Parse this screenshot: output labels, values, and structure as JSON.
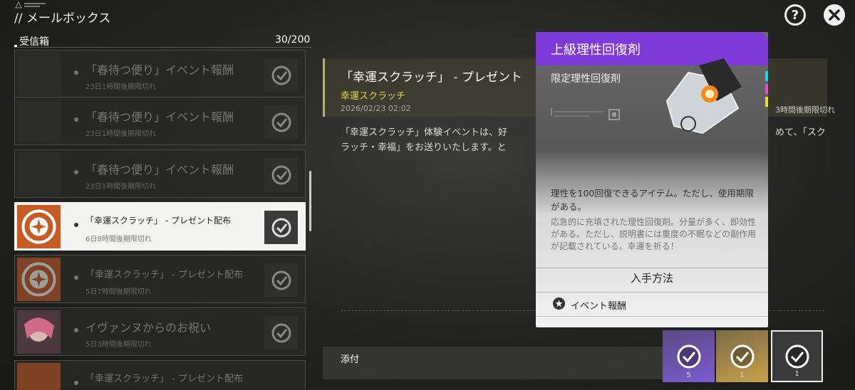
{
  "header": {
    "title": "// メールボックス",
    "help_label": "?"
  },
  "inbox": {
    "label": "受信箱",
    "count": "30/200",
    "items": [
      {
        "title": "「春待つ便り」イベント報酬",
        "sub": "23日1時間後期限切れ",
        "state": "read"
      },
      {
        "title": "「春待つ便り」イベント報酬",
        "sub": "23日1時間後期限切れ",
        "state": "read"
      },
      {
        "title": "「春待つ便り」イベント報酬",
        "sub": "23日1時間後期限切れ",
        "state": "read"
      },
      {
        "title": "「幸運スクラッチ」 - プレゼント配布",
        "sub": "6日8時間後期限切れ",
        "state": "selected"
      },
      {
        "title": "「幸運スクラッチ」 - プレゼント配布",
        "sub": "5日7時間後期限切れ",
        "state": "read"
      },
      {
        "title": "イヴァンヌからのお祝い",
        "sub": "5日3時間後期限切れ",
        "state": "read"
      },
      {
        "title": "「幸運スクラッチ」 - プレゼント配布",
        "sub": "",
        "state": "read"
      }
    ]
  },
  "detail": {
    "title": "「幸運スクラッチ」 - プレゼント",
    "sender": "幸運スクラッチ",
    "date": "2026/02/23 02:02",
    "expiry": "3時間後期限切れ",
    "body_lines": [
      "「幸運スクラッチ」体験イベントは、好",
      "ラッチ・幸福」をお送りいたします。と",
      "めて、「スク"
    ],
    "attach_label": "添付",
    "attachments": [
      {
        "count": "5",
        "color": "#7b5cd1"
      },
      {
        "count": "1",
        "color": "#c9a24a"
      },
      {
        "count": "1",
        "color": "#3a3a3a"
      }
    ]
  },
  "popup": {
    "name": "上級理性回復剤",
    "sub": "限定理性回復剤",
    "desc": "理性を100回復できるアイテム。ただし、使用期限がある。",
    "flavor": "応急的に充填された理性回復剤。分量が多く、即効性がある。ただし、説明書には重度の不眠などの副作用が記載されている。幸運を祈る！",
    "source_header": "入手方法",
    "source_event": "イベント報酬"
  },
  "colors": {
    "accent_purple": "#7e39d9",
    "accent_yellow": "#e9d94a",
    "mail_orange": "#c85a24"
  },
  "icons": [
    "help-icon",
    "close-icon",
    "check-icon",
    "star-icon",
    "cube-icon"
  ]
}
